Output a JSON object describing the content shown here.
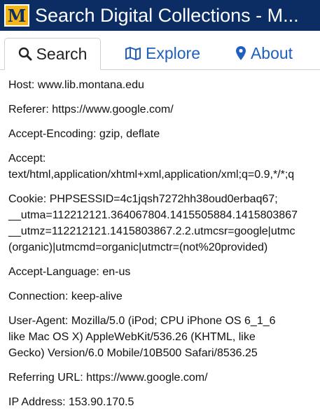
{
  "app": {
    "title": "Search Digital Collections - M...",
    "logo_letter": "M",
    "brand_color": "#0b2d63",
    "logo_color": "#f2b51a"
  },
  "tabs": [
    {
      "label": "Search",
      "icon": "search-icon",
      "active": true
    },
    {
      "label": "Explore",
      "icon": "map-icon",
      "active": false
    },
    {
      "label": "About",
      "icon": "map-pin-icon",
      "active": false
    }
  ],
  "headers": {
    "host": "Host: www.lib.montana.edu",
    "referer": "Referer: https://www.google.com/",
    "accept_encoding": "Accept-Encoding: gzip, deflate",
    "accept_1": "Accept:",
    "accept_2": "text/html,application/xhtml+xml,application/xml;q=0.9,*/*;q",
    "cookie_1": "Cookie: PHPSESSID=4c1jqsh7272hh38oud0erbaq67;",
    "cookie_2": "__utma=112212121.364067804.1415505884.1415803867",
    "cookie_3": "__utmz=112212121.1415803867.2.2.utmcsr=google|utmc",
    "cookie_4": "(organic)|utmcmd=organic|utmctr=(not%20provided)",
    "accept_language": "Accept-Language: en-us",
    "connection": "Connection: keep-alive",
    "user_agent": "User-Agent: Mozilla/5.0 (iPod; CPU iPhone OS 6_1_6 like Mac OS X) AppleWebKit/536.26 (KHTML, like Gecko) Version/6.0 Mobile/10B500 Safari/8536.25",
    "referring_url": "Referring URL: https://www.google.com/",
    "ip_address": "IP Address: 153.90.170.5"
  }
}
